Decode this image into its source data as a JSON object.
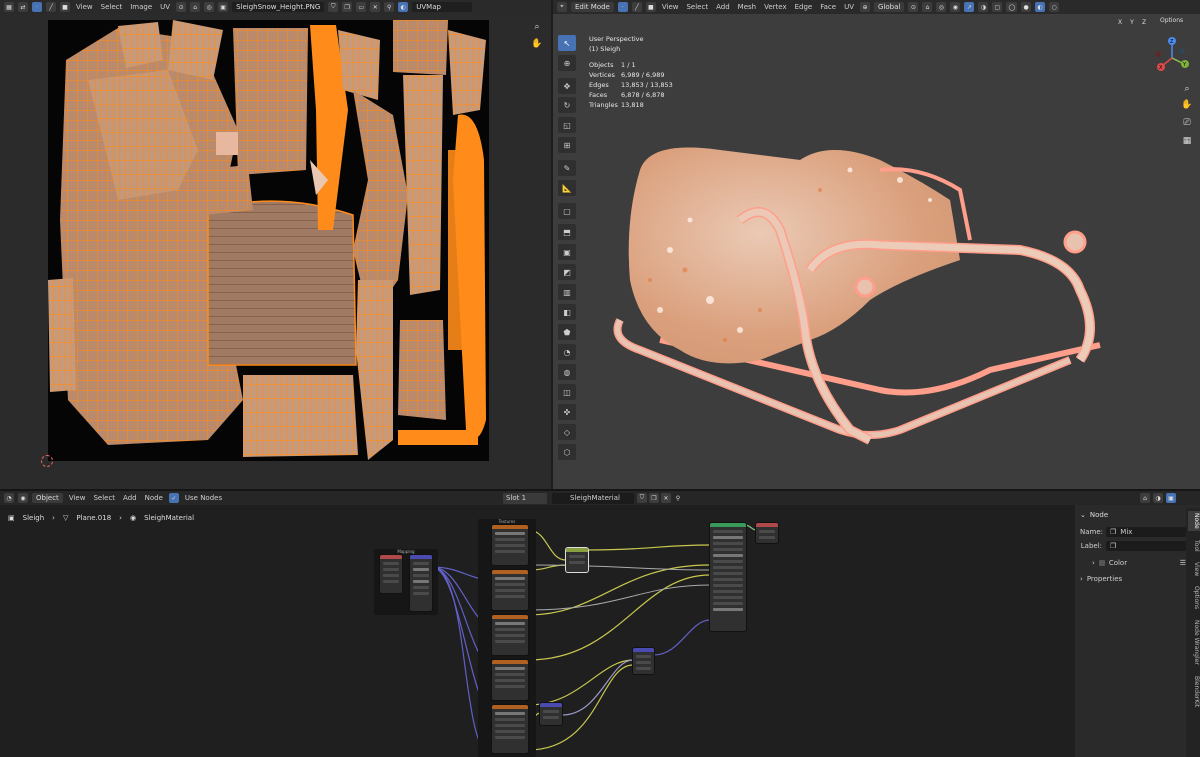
{
  "uv_editor": {
    "header": {
      "menus": [
        "View",
        "Select",
        "Image",
        "UV"
      ],
      "image_name": "SleighSnow_Height.PNG",
      "uv_map": "UVMap"
    }
  },
  "viewport": {
    "header": {
      "mode": "Edit Mode",
      "menus": [
        "View",
        "Select",
        "Add",
        "Mesh",
        "Vertex",
        "Edge",
        "Face",
        "UV"
      ],
      "orientation": "Global",
      "axes": [
        "X",
        "Y",
        "Z"
      ],
      "options": "Options"
    },
    "overlay": {
      "perspective": "User Perspective",
      "object": "(1) Sleigh",
      "stats": [
        {
          "label": "Objects",
          "value": "1 / 1"
        },
        {
          "label": "Vertices",
          "value": "6,989 / 6,989"
        },
        {
          "label": "Edges",
          "value": "13,853 / 13,853"
        },
        {
          "label": "Faces",
          "value": "6,878 / 6,878"
        },
        {
          "label": "Triangles",
          "value": "13,818"
        }
      ]
    },
    "gizmo": {
      "x": "X",
      "y": "Y",
      "z": "Z"
    }
  },
  "node_editor": {
    "header": {
      "object": "Object",
      "menus": [
        "View",
        "Select",
        "Add",
        "Node"
      ],
      "use_nodes": "Use Nodes",
      "slot": "Slot 1",
      "material": "SleighMaterial"
    },
    "breadcrumb": [
      "Sleigh",
      "Plane.018",
      "SleighMaterial"
    ],
    "frames": {
      "frame_a": "Mapping",
      "frame_b": "Textures"
    }
  },
  "sidebar": {
    "section": "Node",
    "name_label": "Name:",
    "name_value": "Mix",
    "label_label": "Label:",
    "label_value": "",
    "color": "Color",
    "properties": "Properties",
    "tabs": [
      "Node",
      "Tool",
      "View",
      "Options",
      "Node Wrangler",
      "BlenderKit"
    ]
  }
}
